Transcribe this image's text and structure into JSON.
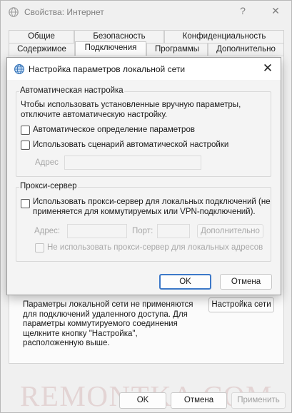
{
  "window": {
    "title": "Свойства: Интернет",
    "help_glyph": "?",
    "close_glyph": "✕"
  },
  "tabs": {
    "row1": [
      "Общие",
      "Безопасность",
      "Конфиденциальность"
    ],
    "row2": [
      "Содержимое",
      "Подключения",
      "Программы",
      "Дополнительно"
    ],
    "active": "Подключения"
  },
  "connections_tab": {
    "lan_hint_lines": [
      "Параметры локальной сети не применяются",
      "для подключений удаленного доступа. Для",
      "параметры коммутируемого соединения",
      "щелкните кнопку \"Настройка\",",
      "расположенную выше."
    ],
    "lan_settings_button": "Настройка сети"
  },
  "bottom_bar": {
    "ok": "OK",
    "cancel": "Отмена",
    "apply": "Применить"
  },
  "watermark": "REMONTKA.COM",
  "dialog": {
    "title": "Настройка параметров локальной сети",
    "close_glyph": "✕",
    "auto_config": {
      "legend": "Автоматическая настройка",
      "description_lines": [
        "Чтобы использовать установленные вручную параметры,",
        "отключите автоматическую настройку."
      ],
      "auto_detect_label": "Автоматическое определение параметров",
      "auto_detect_checked": false,
      "use_script_label": "Использовать сценарий автоматической настройки",
      "use_script_checked": false,
      "address_label": "Адрес",
      "address_value": ""
    },
    "proxy": {
      "legend": "Прокси-сервер",
      "use_proxy_lines": [
        "Использовать прокси-сервер для локальных подключений (не",
        "применяется для коммутируемых или VPN-подключений)."
      ],
      "use_proxy_checked": false,
      "address_label": "Адрес:",
      "address_value": "",
      "port_label": "Порт:",
      "port_value": "",
      "advanced_button": "Дополнительно",
      "bypass_label": "Не использовать прокси-сервер для локальных адресов",
      "bypass_checked": false
    },
    "ok": "OK",
    "cancel": "Отмена"
  }
}
